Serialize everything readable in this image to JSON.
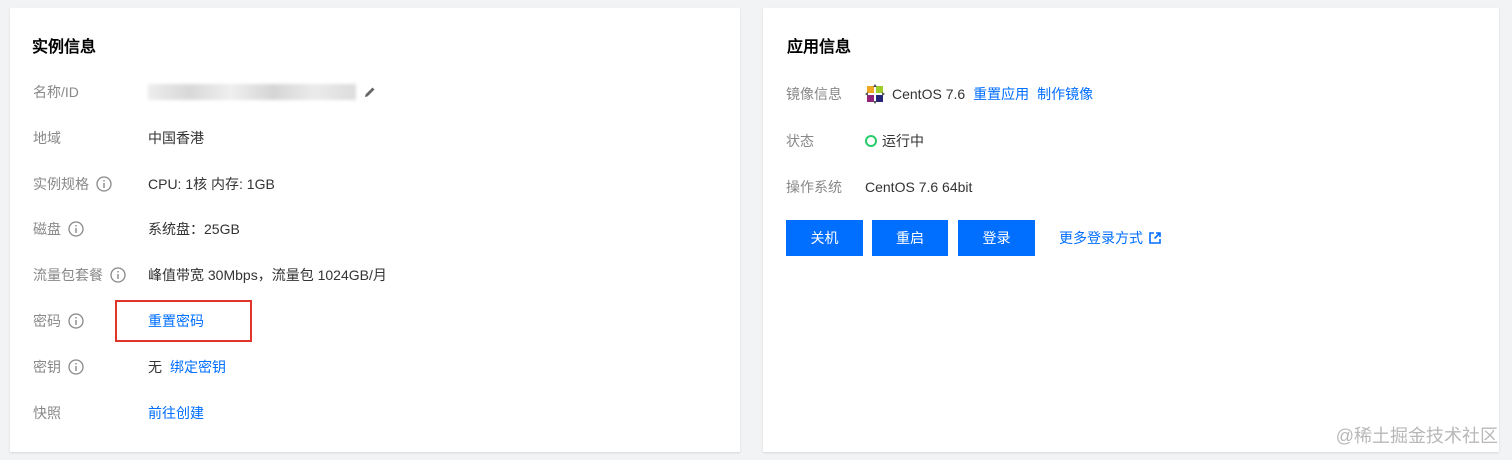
{
  "instance_card": {
    "title": "实例信息",
    "name_id_label": "名称/ID",
    "region_label": "地域",
    "region_value": "中国香港",
    "spec_label": "实例规格",
    "spec_value": "CPU: 1核 内存: 1GB",
    "disk_label": "磁盘",
    "disk_value": "系统盘：25GB",
    "traffic_label": "流量包套餐",
    "traffic_value": "峰值带宽 30Mbps，流量包 1024GB/月",
    "password_label": "密码",
    "password_link": "重置密码",
    "key_label": "密钥",
    "key_value": "无",
    "key_link": "绑定密钥",
    "snapshot_label": "快照",
    "snapshot_link": "前往创建"
  },
  "app_card": {
    "title": "应用信息",
    "image_label": "镜像信息",
    "image_value": "CentOS 7.6",
    "reset_app_link": "重置应用",
    "make_image_link": "制作镜像",
    "status_label": "状态",
    "status_value": "运行中",
    "os_label": "操作系统",
    "os_value": "CentOS 7.6 64bit",
    "btn_shutdown": "关机",
    "btn_restart": "重启",
    "btn_login": "登录",
    "more_login_link": "更多登录方式"
  },
  "watermark": "@稀土掘金技术社区",
  "colors": {
    "accent": "#006eff",
    "status_running": "#29cc6a",
    "highlight_border": "#e0352b"
  },
  "icons": [
    "info-icon",
    "edit-icon",
    "centos-logo-icon",
    "status-running-icon",
    "external-link-icon"
  ]
}
